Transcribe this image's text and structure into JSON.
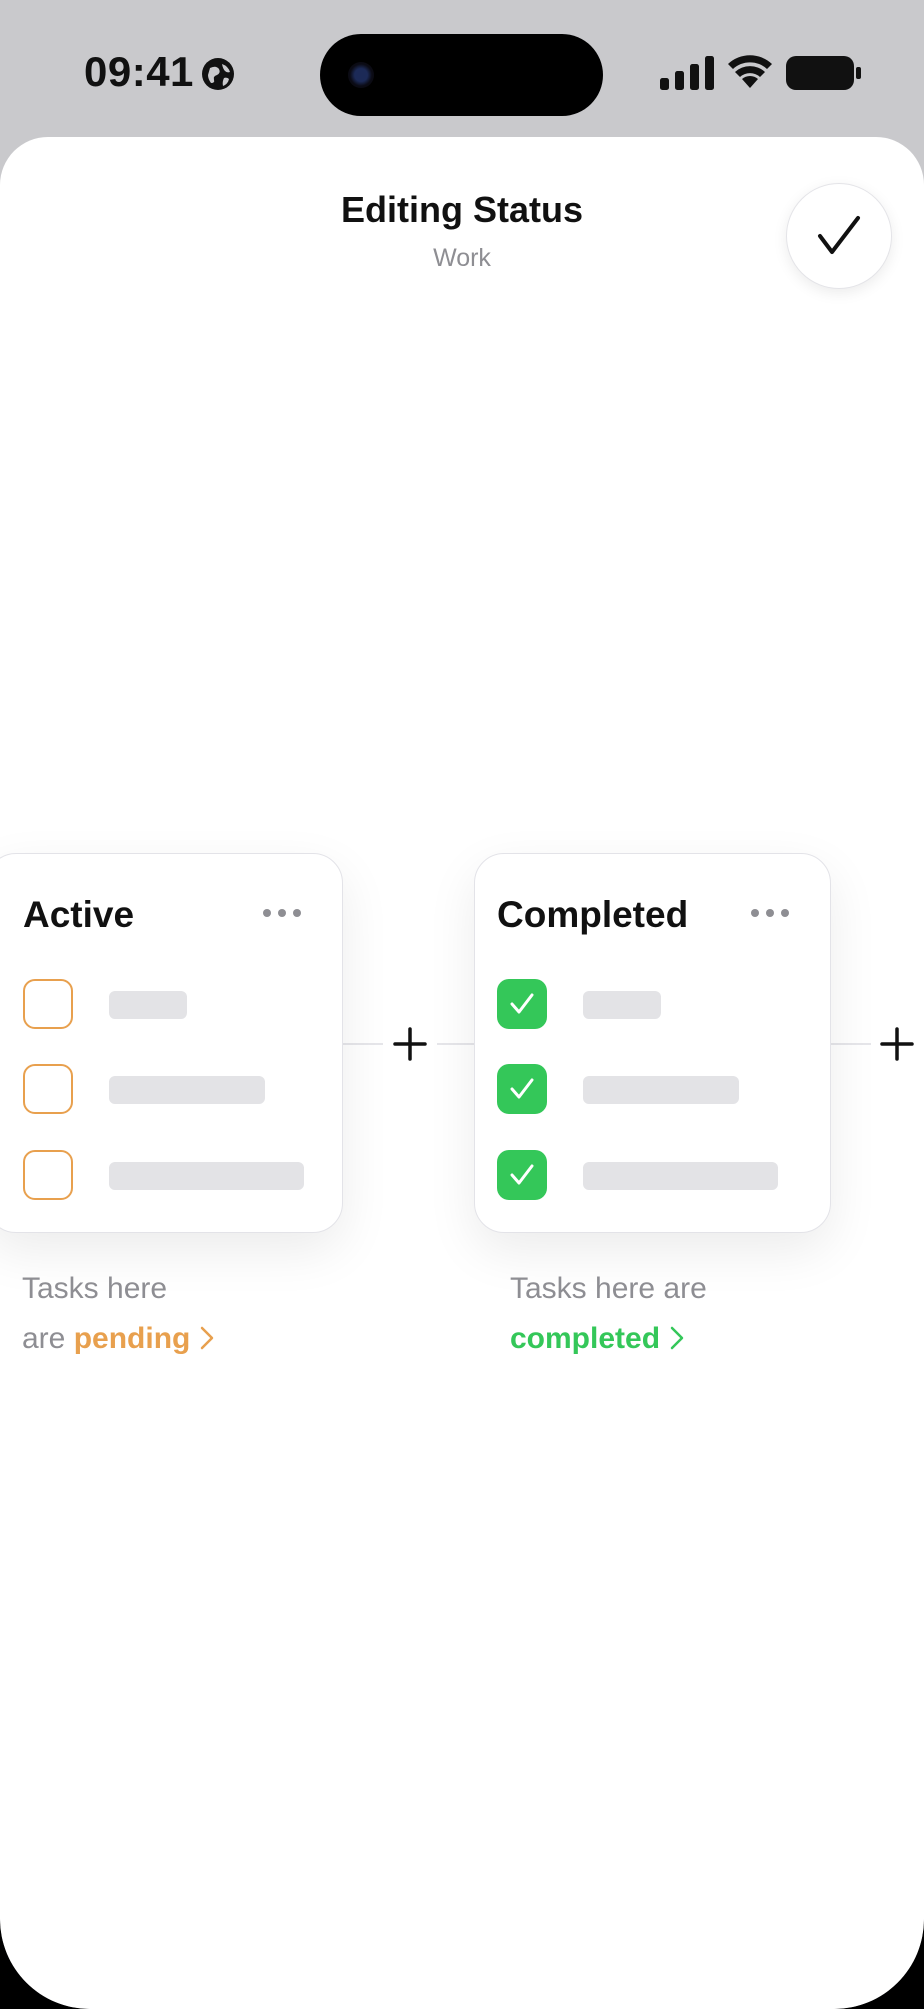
{
  "status_bar": {
    "time": "09:41"
  },
  "sheet": {
    "title": "Editing Status",
    "subtitle": "Work"
  },
  "columns": [
    {
      "title": "Active",
      "checkbox_state": "unchecked",
      "accent_color": "#e8a04e",
      "description_prefix": "Tasks here",
      "description_prefix2": "are",
      "description_link": "pending",
      "task_count": 3
    },
    {
      "title": "Completed",
      "checkbox_state": "checked",
      "accent_color": "#34c759",
      "description_prefix": "Tasks here are",
      "description_link": "completed",
      "task_count": 3
    }
  ],
  "icons": {
    "done": "checkmark-icon",
    "add": "plus-icon",
    "more": "ellipsis-icon",
    "chevron": "chevron-right-icon"
  },
  "colors": {
    "pending": "#e8a04e",
    "completed": "#34c759",
    "secondary_text": "#8e8e93"
  }
}
